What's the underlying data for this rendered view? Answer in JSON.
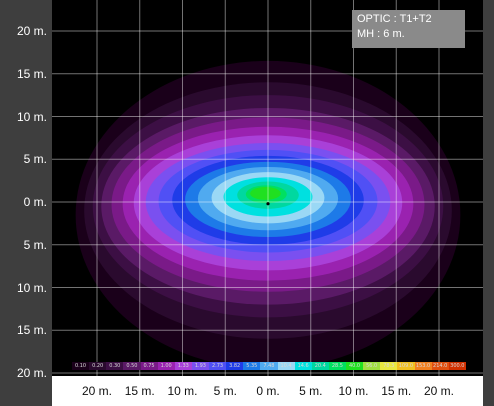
{
  "info": {
    "line1": "OPTIC : T1+T2",
    "line2": "MH : 6 m."
  },
  "chart_data": {
    "type": "heatmap",
    "title": "",
    "xlabel": "",
    "ylabel": "",
    "x_ticks": [
      "20 m.",
      "15 m.",
      "10 m.",
      "5 m.",
      "0 m.",
      "5 m.",
      "10 m.",
      "15 m.",
      "20 m."
    ],
    "y_ticks": [
      "20 m.",
      "15 m.",
      "10 m.",
      "5 m.",
      "0 m.",
      "5 m.",
      "10 m.",
      "15 m.",
      "20 m."
    ],
    "xlim": [
      -25,
      25
    ],
    "ylim": [
      -22,
      22
    ],
    "grid": true,
    "legend_position": "bottom",
    "levels": [
      {
        "value": "0.10",
        "color": "#1a001a"
      },
      {
        "value": "0.20",
        "color": "#2a0a2e"
      },
      {
        "value": "0.30",
        "color": "#3c0f44"
      },
      {
        "value": "0.50",
        "color": "#5a1a66"
      },
      {
        "value": "0.75",
        "color": "#7a1a88"
      },
      {
        "value": "1.00",
        "color": "#9a22b0"
      },
      {
        "value": "1.33",
        "color": "#a940d8"
      },
      {
        "value": "1.93",
        "color": "#7a50f0"
      },
      {
        "value": "2.73",
        "color": "#5050f5"
      },
      {
        "value": "3.82",
        "color": "#1f3ce8"
      },
      {
        "value": "5.35",
        "color": "#1d7ae8"
      },
      {
        "value": "7.48",
        "color": "#50aaf0"
      },
      {
        "value": "10.4",
        "color": "#9ad8f5"
      },
      {
        "value": "14.6",
        "color": "#00e0e0"
      },
      {
        "value": "20.4",
        "color": "#00d8a0"
      },
      {
        "value": "28.5",
        "color": "#00e060"
      },
      {
        "value": "40.0",
        "color": "#20e020"
      },
      {
        "value": "56.0",
        "color": "#a0e040"
      },
      {
        "value": "78.3",
        "color": "#e8e840"
      },
      {
        "value": "109.0",
        "color": "#f0c020"
      },
      {
        "value": "153.0",
        "color": "#f08020"
      },
      {
        "value": "214.0",
        "color": "#e05010"
      },
      {
        "value": "300.0",
        "color": "#d03000"
      }
    ],
    "contours": [
      {
        "color": "#1a001a",
        "rx": 22.5,
        "ry": 18.0,
        "cx": 0.0,
        "cy": -1.5
      },
      {
        "color": "#2a0a2e",
        "rx": 21.5,
        "ry": 15.0,
        "cx": 0.0,
        "cy": -1.0
      },
      {
        "color": "#3c0f44",
        "rx": 20.5,
        "ry": 13.0,
        "cx": 0.0,
        "cy": -0.5
      },
      {
        "color": "#5a1a66",
        "rx": 19.5,
        "ry": 11.5,
        "cx": 0.0,
        "cy": -0.5
      },
      {
        "color": "#7a1a88",
        "rx": 18.3,
        "ry": 10.2,
        "cx": 0.0,
        "cy": -0.3
      },
      {
        "color": "#9a22b0",
        "rx": 17.0,
        "ry": 9.0,
        "cx": 0.0,
        "cy": -0.2
      },
      {
        "color": "#a940d8",
        "rx": 15.7,
        "ry": 7.9,
        "cx": 0.0,
        "cy": -0.1
      },
      {
        "color": "#7a50f0",
        "rx": 14.3,
        "ry": 6.9,
        "cx": 0.0,
        "cy": 0.0
      },
      {
        "color": "#5050f5",
        "rx": 12.8,
        "ry": 6.0,
        "cx": 0.0,
        "cy": 0.1
      },
      {
        "color": "#1f3ce8",
        "rx": 11.2,
        "ry": 5.2,
        "cx": 0.0,
        "cy": 0.2
      },
      {
        "color": "#1d7ae8",
        "rx": 9.7,
        "ry": 4.4,
        "cx": 0.0,
        "cy": 0.3
      },
      {
        "color": "#50aaf0",
        "rx": 8.2,
        "ry": 3.7,
        "cx": 0.0,
        "cy": 0.4
      },
      {
        "color": "#9ad8f5",
        "rx": 6.6,
        "ry": 3.0,
        "cx": 0.0,
        "cy": 0.5
      },
      {
        "color": "#00e0e0",
        "rx": 5.2,
        "ry": 2.3,
        "cx": 0.0,
        "cy": 0.6
      },
      {
        "color": "#00d8a0",
        "rx": 3.6,
        "ry": 1.6,
        "cx": 0.0,
        "cy": 0.8
      },
      {
        "color": "#00e060",
        "rx": 2.4,
        "ry": 1.05,
        "cx": -0.2,
        "cy": 0.9
      },
      {
        "color": "#20e020",
        "rx": 1.8,
        "ry": 0.75,
        "cx": -0.3,
        "cy": 1.0
      }
    ],
    "center_marker": {
      "x": 0.0,
      "y": -0.2
    }
  }
}
